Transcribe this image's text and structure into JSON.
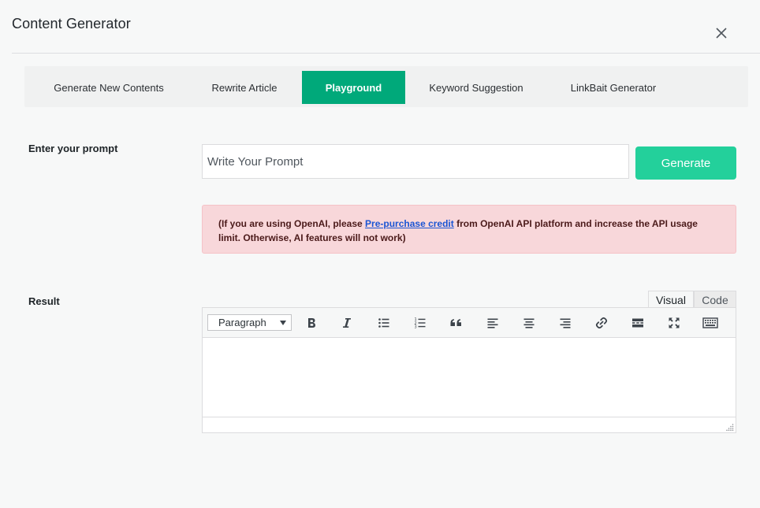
{
  "modal": {
    "title": "Content Generator"
  },
  "tabs": [
    {
      "label": "Generate New Contents",
      "active": false
    },
    {
      "label": "Rewrite Article",
      "active": false
    },
    {
      "label": "Playground",
      "active": true
    },
    {
      "label": "Keyword Suggestion",
      "active": false
    },
    {
      "label": "LinkBait Generator",
      "active": false
    }
  ],
  "prompt": {
    "label": "Enter your prompt",
    "placeholder": "Write Your Prompt",
    "value": "",
    "button_label": "Generate"
  },
  "notice": {
    "text_before": "(If you are using OpenAI, please ",
    "link_text": "Pre-purchase credit",
    "text_after": " from OpenAI API platform and increase the API usage limit. Otherwise, AI features will not work)"
  },
  "result": {
    "label": "Result",
    "editor_tabs": {
      "visual": "Visual",
      "code": "Code"
    },
    "format_select": "Paragraph",
    "toolbar_icons": [
      "bold-icon",
      "italic-icon",
      "bullet-list-icon",
      "numbered-list-icon",
      "blockquote-icon",
      "align-left-icon",
      "align-center-icon",
      "align-right-icon",
      "link-icon",
      "read-more-icon",
      "fullscreen-icon",
      "toolbar-toggle-icon"
    ]
  },
  "colors": {
    "accent": "#00a97a",
    "button": "#23d09b",
    "notice_bg": "#f8d7da",
    "link": "#1a55d4"
  }
}
